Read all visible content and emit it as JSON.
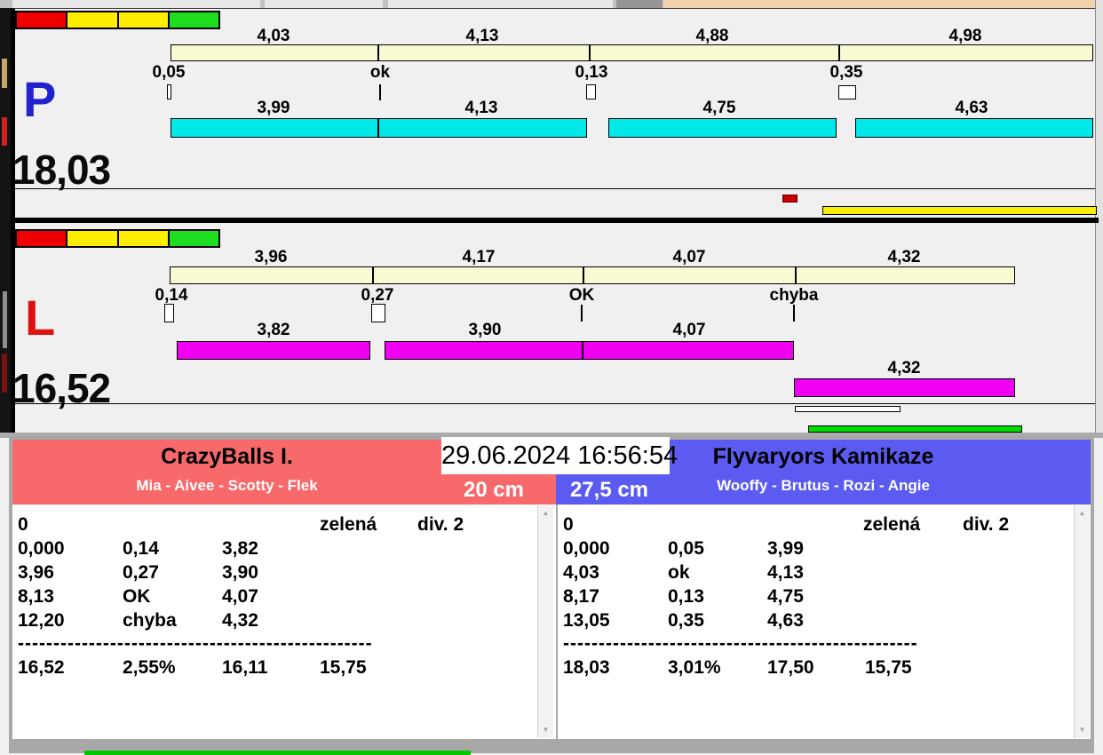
{
  "colors": {
    "split_bar": "#FAFAD2",
    "lane_p_run_bar": "#00E8E8",
    "lane_l_run_bar": "#F000F0",
    "traffic_light": [
      "#EE0000",
      "#FFEE00",
      "#FFEE00",
      "#1EDC1E"
    ],
    "lane_p_letter": "#2222CC",
    "lane_l_letter": "#DD1111",
    "team_left_header": "#F7696B",
    "team_right_header": "#5B5BF2",
    "p_extra_bar": "#F8F000",
    "l_extra_bar": "#00DC00"
  },
  "lane_p": {
    "letter": "P",
    "total": "18,03",
    "split_labels": [
      "4,03",
      "4,13",
      "4,88",
      "4,98"
    ],
    "pass_labels": [
      "0,05",
      "ok",
      "0,13",
      "0,35"
    ],
    "run_labels": [
      "3,99",
      "4,13",
      "4,75",
      "4,63"
    ]
  },
  "lane_l": {
    "letter": "L",
    "total": "16,52",
    "split_labels": [
      "3,96",
      "4,17",
      "4,07",
      "4,32"
    ],
    "pass_labels": [
      "0,14",
      "0,27",
      "OK",
      "chyba"
    ],
    "run_labels": [
      "3,82",
      "3,90",
      "4,07"
    ],
    "rerun_label": "4,32"
  },
  "scoreboard": {
    "timestamp": "29.06.2024 16:56:54",
    "left": {
      "team": "CrazyBalls I.",
      "dogs": "Mia - Aivee - Scotty - Flek",
      "jump_height": "20 cm",
      "rows": [
        [
          "0",
          "",
          "",
          "zelená",
          "div. 2"
        ],
        [
          "0,000",
          "0,14",
          "3,82",
          "",
          ""
        ],
        [
          "3,96",
          "0,27",
          "3,90",
          "",
          ""
        ],
        [
          "8,13",
          "OK",
          "4,07",
          "",
          ""
        ],
        [
          "12,20",
          "chyba",
          "4,32",
          "",
          ""
        ]
      ],
      "separator": "--------------------------------------------------",
      "summary": [
        "16,52",
        "2,55%",
        "16,11",
        "15,75"
      ]
    },
    "right": {
      "team": "Flyvaryors Kamikaze",
      "dogs": "Wooffy - Brutus - Rozi - Angie",
      "jump_height": "27,5 cm",
      "rows": [
        [
          "0",
          "",
          "",
          "zelená",
          "div. 2"
        ],
        [
          "0,000",
          "0,05",
          "3,99",
          "",
          ""
        ],
        [
          "4,03",
          "ok",
          "4,13",
          "",
          ""
        ],
        [
          "8,17",
          "0,13",
          "4,75",
          "",
          ""
        ],
        [
          "13,05",
          "0,35",
          "4,63",
          "",
          ""
        ]
      ],
      "separator": "--------------------------------------------------",
      "summary": [
        "18,03",
        "3,01%",
        "17,50",
        "15,75"
      ]
    },
    "scroll_up_glyph": "▲",
    "scroll_down_glyph": "▼"
  }
}
